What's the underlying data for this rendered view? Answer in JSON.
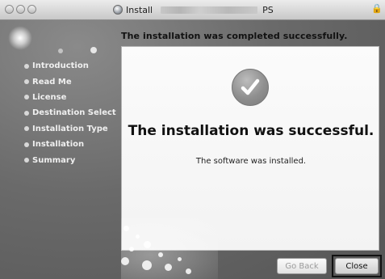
{
  "window": {
    "title_prefix": "Install",
    "title_suffix": "PS"
  },
  "headline": "The installation was completed successfully.",
  "sidebar": {
    "items": [
      {
        "label": "Introduction"
      },
      {
        "label": "Read Me"
      },
      {
        "label": "License"
      },
      {
        "label": "Destination Select"
      },
      {
        "label": "Installation Type"
      },
      {
        "label": "Installation"
      },
      {
        "label": "Summary"
      }
    ]
  },
  "main": {
    "success_title": "The installation was successful.",
    "success_message": "The software was installed.",
    "icon": "checkmark-icon"
  },
  "buttons": {
    "go_back": "Go Back",
    "close": "Close"
  }
}
